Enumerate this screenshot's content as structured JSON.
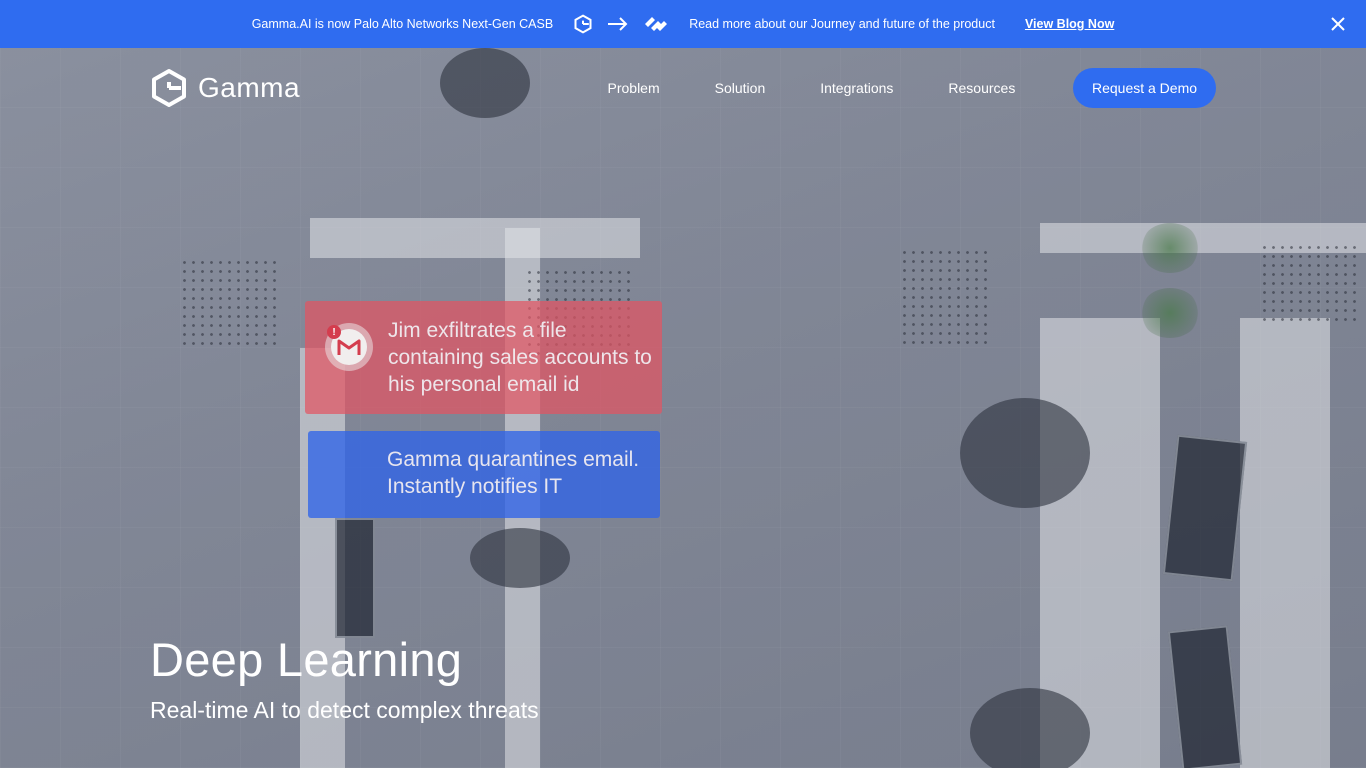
{
  "banner": {
    "message": "Gamma.AI is now Palo Alto Networks Next-Gen CASB",
    "icons": [
      "gamma-logo-icon",
      "arrow-right-icon",
      "palo-alto-logo-icon"
    ],
    "journey_text": "Read more about our Journey and future of the product",
    "link_label": "View Blog Now",
    "close_icon": "close-icon",
    "bg_color": "#2f6cf0"
  },
  "nav": {
    "logo_text": "Gamma",
    "links": [
      {
        "label": "Problem"
      },
      {
        "label": "Solution"
      },
      {
        "label": "Integrations"
      },
      {
        "label": "Resources"
      }
    ],
    "cta_label": "Request a Demo",
    "cta_color": "#2f6cf0"
  },
  "alerts": {
    "threat": {
      "icon": "gmail-icon",
      "badge": "!",
      "text": "Jim exfiltrates a file containing sales accounts to his personal email id",
      "color": "#e25462"
    },
    "response": {
      "text": "Gamma quarantines email. Instantly notifies IT",
      "color": "#2f64e8"
    }
  },
  "hero": {
    "title": "Deep Learning",
    "subtitle": "Real-time AI to detect complex threats"
  }
}
